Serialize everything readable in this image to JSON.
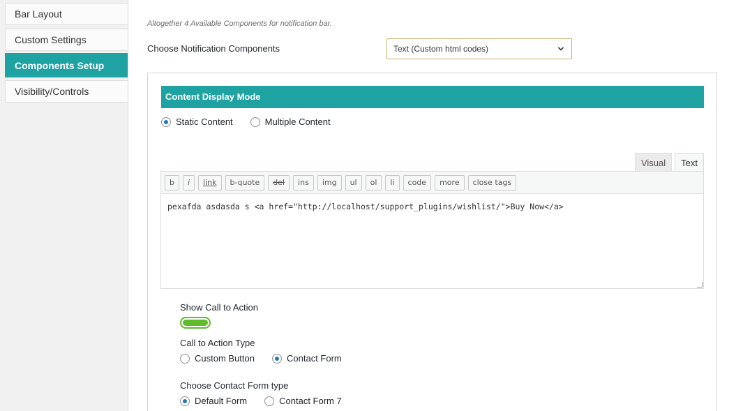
{
  "sidebar": {
    "tabs": [
      {
        "label": "Bar Layout"
      },
      {
        "label": "Custom Settings"
      },
      {
        "label": "Components Setup"
      },
      {
        "label": "Visibility/Controls"
      }
    ]
  },
  "main": {
    "hint": "Altogether 4 Available Components for notification bar.",
    "choose_label": "Choose Notification Components",
    "select_value": "Text (Custom html codes)",
    "panel_header": "Content Display Mode",
    "display_mode": {
      "options": [
        "Static Content",
        "Multiple Content"
      ],
      "selected": "Static Content"
    },
    "editor": {
      "tabs": [
        "Visual",
        "Text"
      ],
      "active_tab": "Text",
      "toolbar": [
        "b",
        "i",
        "link",
        "b-quote",
        "del",
        "ins",
        "img",
        "ul",
        "ol",
        "li",
        "code",
        "more",
        "close tags"
      ],
      "content": "pexafda asdasda s <a href=\"http://localhost/support_plugins/wishlist/\">Buy Now</a>"
    },
    "cta": {
      "show_label": "Show Call to Action",
      "show_enabled": true,
      "type_label": "Call to Action Type",
      "type_options": [
        "Custom Button",
        "Contact Form"
      ],
      "type_selected": "Contact Form",
      "form_label": "Choose Contact Form type",
      "form_options": [
        "Default Form",
        "Contact Form 7"
      ],
      "form_selected": "Default Form"
    }
  },
  "colors": {
    "accent": "#1fa2a2",
    "toggle_on": "#5fbb2c",
    "radio_dot": "#1f7ab8",
    "select_border": "#c9b16b"
  }
}
